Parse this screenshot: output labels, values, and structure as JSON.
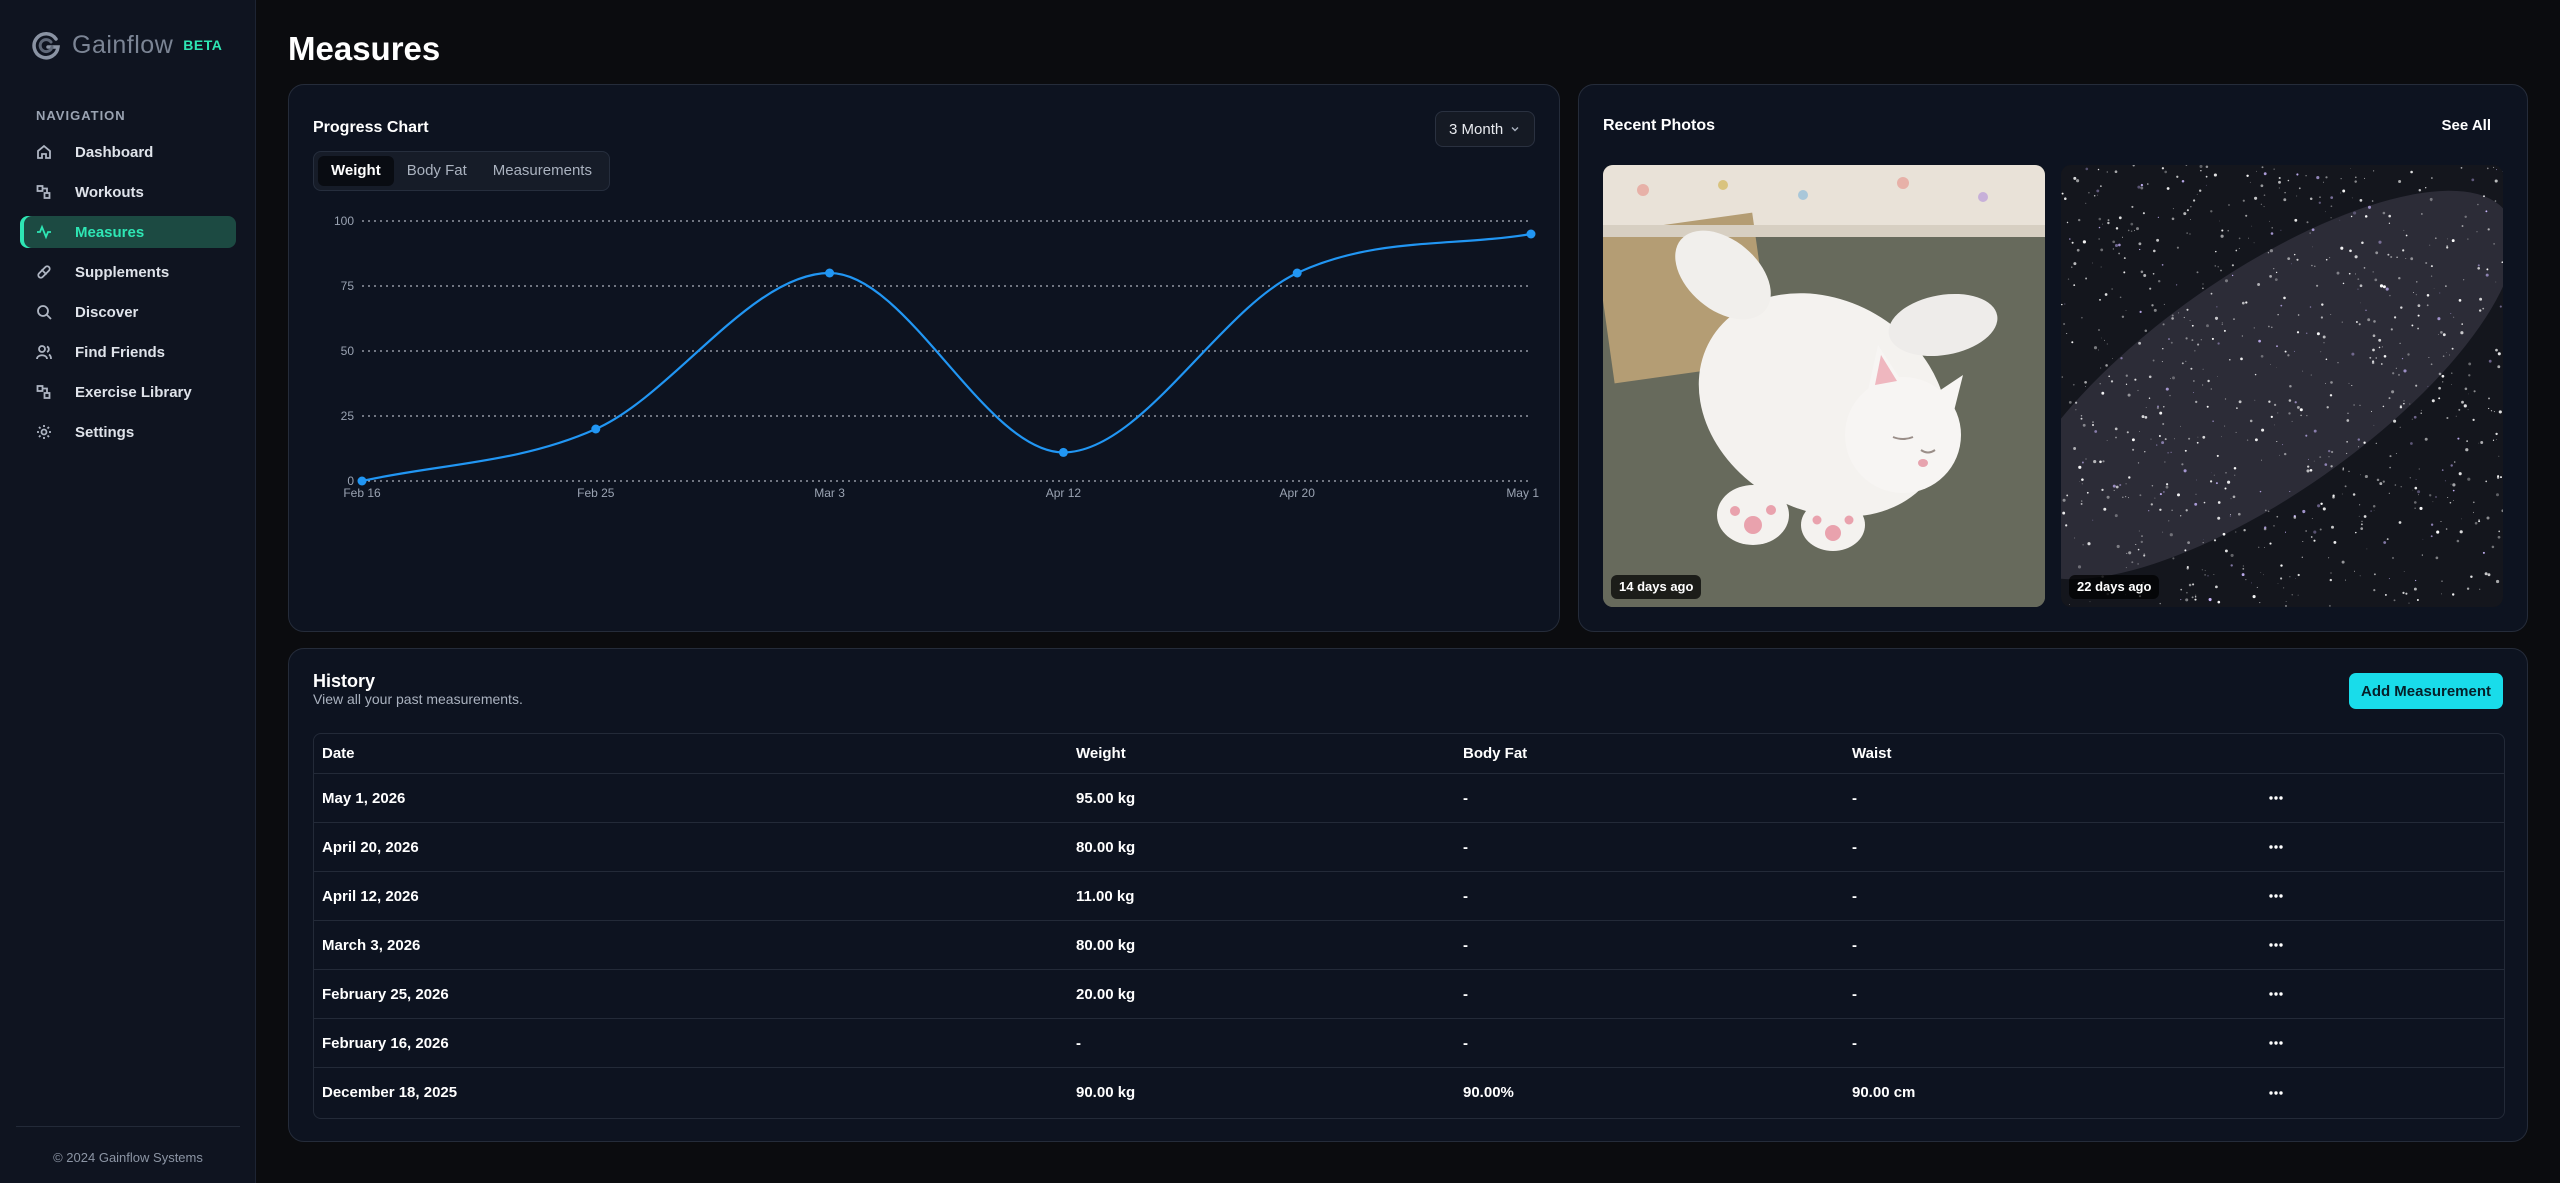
{
  "app": {
    "name": "Gainflow",
    "badge": "BETA",
    "copyright": "© 2024 Gainflow Systems"
  },
  "sidebar": {
    "heading": "NAVIGATION",
    "items": [
      {
        "label": "Dashboard",
        "icon": "home-icon"
      },
      {
        "label": "Workouts",
        "icon": "workouts-icon"
      },
      {
        "label": "Measures",
        "icon": "activity-icon",
        "active": true
      },
      {
        "label": "Supplements",
        "icon": "pill-icon"
      },
      {
        "label": "Discover",
        "icon": "search-icon"
      },
      {
        "label": "Find Friends",
        "icon": "users-icon"
      },
      {
        "label": "Exercise Library",
        "icon": "library-icon"
      },
      {
        "label": "Settings",
        "icon": "gear-icon"
      }
    ]
  },
  "page": {
    "title": "Measures"
  },
  "progress": {
    "title": "Progress Chart",
    "range_label": "3 Month",
    "tabs": [
      "Weight",
      "Body Fat",
      "Measurements"
    ],
    "active_tab": "Weight"
  },
  "chart_data": {
    "type": "line",
    "title": "",
    "xlabel": "",
    "ylabel": "",
    "x": [
      "Feb 16",
      "Feb 25",
      "Mar 3",
      "Apr 12",
      "Apr 20",
      "May 1"
    ],
    "values": [
      0,
      20,
      80,
      11,
      80,
      95
    ],
    "yticks": [
      0,
      25,
      50,
      75,
      100
    ],
    "ylim": [
      0,
      100
    ],
    "grid": "dotted horizontal",
    "color": "#2196f3"
  },
  "photos": {
    "title": "Recent Photos",
    "see_all": "See All",
    "items": [
      {
        "ago": "14 days ago",
        "subject": "white-cat-photo"
      },
      {
        "ago": "22 days ago",
        "subject": "starfield-photo"
      }
    ]
  },
  "history": {
    "title": "History",
    "subtitle": "View all your past measurements.",
    "add_button": "Add Measurement",
    "columns": [
      "Date",
      "Weight",
      "Body Fat",
      "Waist"
    ],
    "rows": [
      {
        "date": "May 1, 2026",
        "weight": "95.00 kg",
        "fat": "-",
        "waist": "-"
      },
      {
        "date": "April 20, 2026",
        "weight": "80.00 kg",
        "fat": "-",
        "waist": "-"
      },
      {
        "date": "April 12, 2026",
        "weight": "11.00 kg",
        "fat": "-",
        "waist": "-"
      },
      {
        "date": "March 3, 2026",
        "weight": "80.00 kg",
        "fat": "-",
        "waist": "-"
      },
      {
        "date": "February 25, 2026",
        "weight": "20.00 kg",
        "fat": "-",
        "waist": "-"
      },
      {
        "date": "February 16, 2026",
        "weight": "-",
        "fat": "-",
        "waist": "-"
      },
      {
        "date": "December 18, 2025",
        "weight": "90.00 kg",
        "fat": "90.00%",
        "waist": "90.00 cm"
      }
    ],
    "more_icon": "more-horizontal-icon"
  },
  "colors": {
    "accent": "#2ee6b4",
    "button": "#19dcea",
    "line": "#2196f3"
  }
}
